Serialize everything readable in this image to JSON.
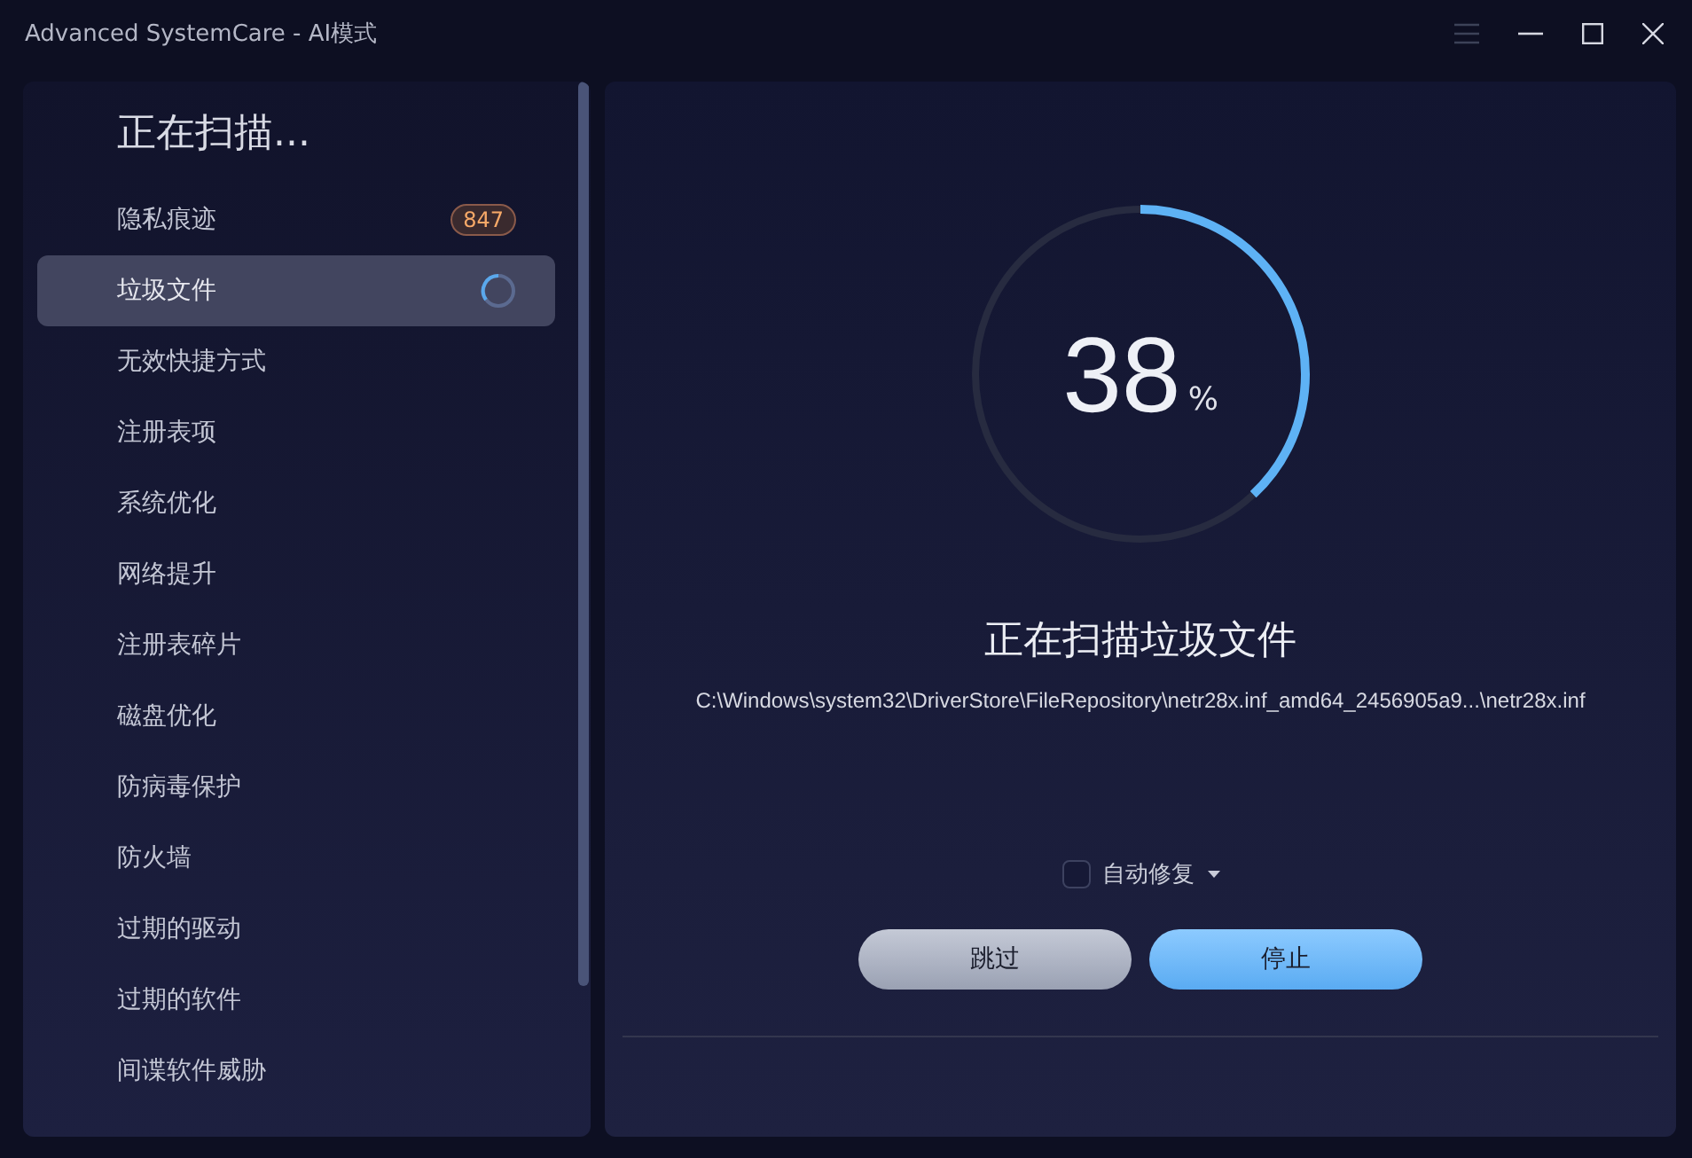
{
  "window": {
    "title": "Advanced SystemCare - AI模式"
  },
  "sidebar": {
    "heading": "正在扫描...",
    "items": [
      {
        "label": "隐私痕迹",
        "selected": false,
        "kind": "count",
        "count": "847"
      },
      {
        "label": "垃圾文件",
        "selected": true,
        "kind": "scanning"
      },
      {
        "label": "无效快捷方式",
        "selected": false
      },
      {
        "label": "注册表项",
        "selected": false
      },
      {
        "label": "系统优化",
        "selected": false
      },
      {
        "label": "网络提升",
        "selected": false
      },
      {
        "label": "注册表碎片",
        "selected": false
      },
      {
        "label": "磁盘优化",
        "selected": false
      },
      {
        "label": "防病毒保护",
        "selected": false
      },
      {
        "label": "防火墙",
        "selected": false
      },
      {
        "label": "过期的驱动",
        "selected": false
      },
      {
        "label": "过期的软件",
        "selected": false
      },
      {
        "label": "间谍软件威胁",
        "selected": false
      }
    ]
  },
  "progress": {
    "level": 0.38,
    "value": "38",
    "unit": "%"
  },
  "status": {
    "title": "正在扫描垃圾文件",
    "path": "C:\\Windows\\system32\\DriverStore\\FileRepository\\netr28x.inf_amd64_2456905a9...\\netr28x.inf"
  },
  "auto_fix": {
    "label": "自动修复",
    "checked": false
  },
  "buttons": [
    {
      "label": "跳过",
      "kind": "secondary"
    },
    {
      "label": "停止",
      "kind": "primary"
    }
  ]
}
